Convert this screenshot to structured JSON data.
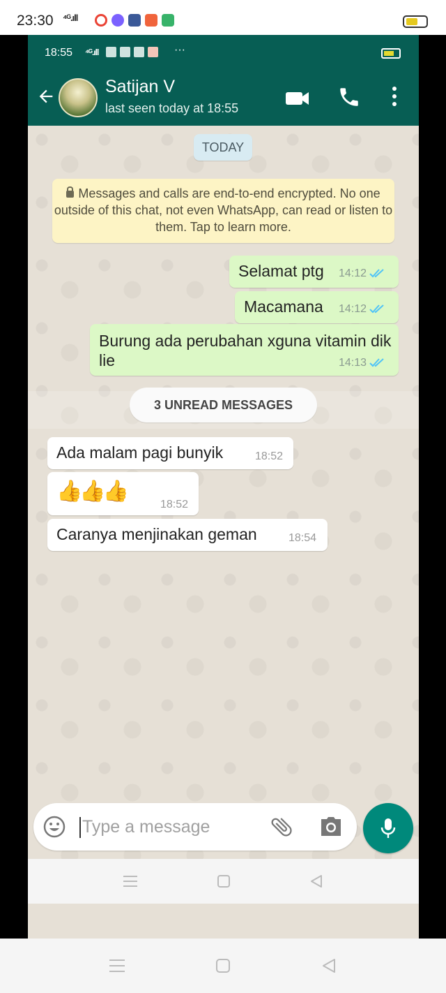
{
  "device": {
    "outer_time": "23:30",
    "outer_net": "⁴ᴳ.ıll",
    "inner_time": "18:55",
    "inner_net": "⁴ᴳ.ıll",
    "inner_more": "···"
  },
  "header": {
    "contact_name": "Satijan V",
    "last_seen": "last seen today at 18:55"
  },
  "chat": {
    "date_chip": "TODAY",
    "encryption_notice": "Messages and calls are end-to-end encrypted. No one outside of this chat, not even WhatsApp, can read or listen to them. Tap to learn more.",
    "unread_divider": "3 UNREAD MESSAGES",
    "outgoing": [
      {
        "text": "Selamat ptg",
        "time": "14:12",
        "status": "read"
      },
      {
        "text": "Macamana",
        "time": "14:12",
        "status": "read"
      },
      {
        "text": "Burung ada perubahan xguna vitamin dik lie",
        "time": "14:13",
        "status": "read"
      }
    ],
    "incoming": [
      {
        "text": "Ada  malam pagi bunyik",
        "time": "18:52"
      },
      {
        "text": "👍👍👍",
        "time": "18:52"
      },
      {
        "text": "Caranya  menjinakan geman",
        "time": "18:54"
      }
    ]
  },
  "composer": {
    "placeholder": "Type a message"
  },
  "colors": {
    "header": "#075e54",
    "outgoing_bubble": "#dcf8c6",
    "incoming_bubble": "#ffffff",
    "read_tick": "#4fc3f7",
    "mic_button": "#00897b"
  }
}
